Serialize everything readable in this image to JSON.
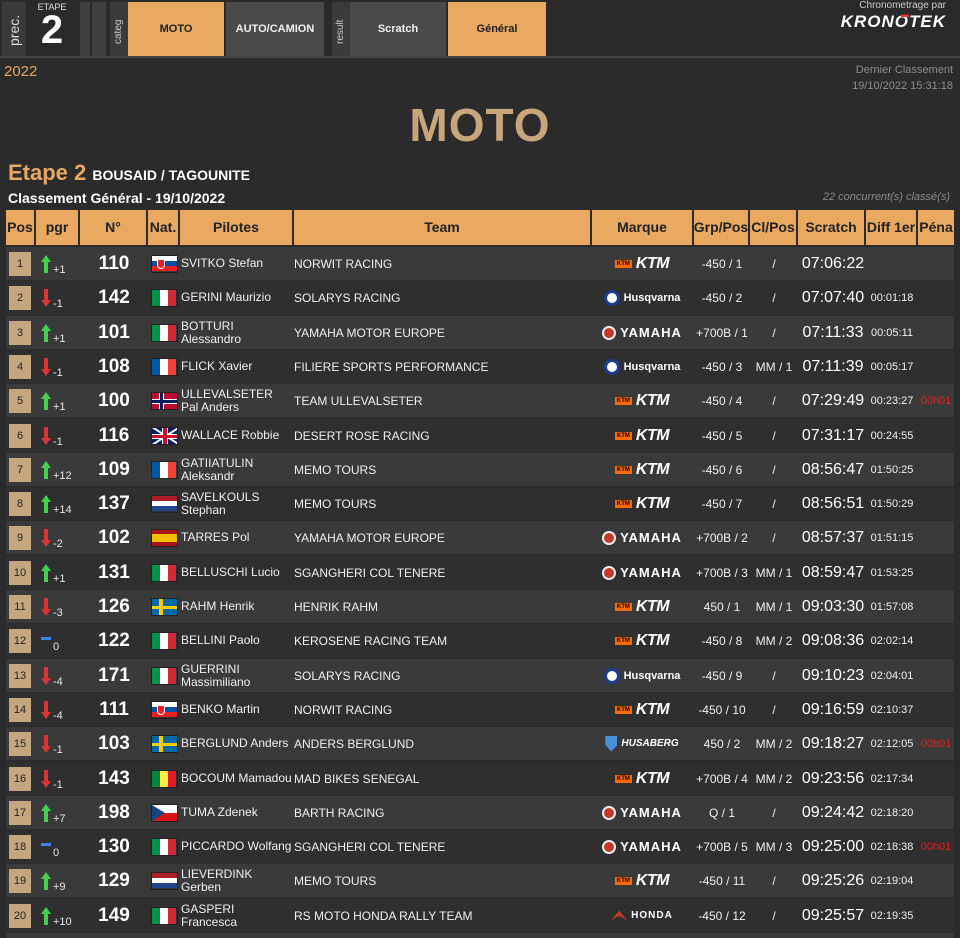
{
  "header": {
    "prec_label": "prec.",
    "etape_label": "ETAPE",
    "etape_num": "2",
    "categ_label": "categ",
    "result_label": "result",
    "tabs": [
      {
        "label": "MOTO",
        "active": true
      },
      {
        "label": "AUTO/CAMION",
        "active": false
      },
      {
        "label": "Scratch",
        "active": false
      },
      {
        "label": "Général",
        "active": true
      }
    ],
    "chrono_label": "Chronometrage par",
    "brand": "KRONOTEK"
  },
  "year": "2022",
  "dernier": {
    "label": "Dernier Classement",
    "datetime": "19/10/2022 15:31:18"
  },
  "page_title": "MOTO",
  "stage": {
    "etape": "Etape 2",
    "route": "BOUSAID / TAGOUNITE",
    "classement": "Classement Général - 19/10/2022",
    "concurrents": "22 concurrent(s) classé(s)"
  },
  "columns": [
    "Pos",
    "pgr",
    "N°",
    "Nat.",
    "Pilotes",
    "Team",
    "Marque",
    "Grp/Pos",
    "Cl/Pos",
    "Scratch",
    "Diff 1er",
    "Péna"
  ],
  "rows": [
    {
      "pos": "1",
      "dir": "up",
      "pgr": "+1",
      "no": "110",
      "nat": "SVK",
      "pilote": "SVITKO Stefan",
      "team": "NORWIT RACING",
      "marque": "KTM",
      "grp": "-450 / 1",
      "cl": "/",
      "scratch": "07:06:22",
      "diff": "",
      "pena": ""
    },
    {
      "pos": "2",
      "dir": "down",
      "pgr": "-1",
      "no": "142",
      "nat": "ITA",
      "pilote": "GERINI Maurizio",
      "team": "SOLARYS RACING",
      "marque": "Husqvarna",
      "grp": "-450 / 2",
      "cl": "/",
      "scratch": "07:07:40",
      "diff": "00:01:18",
      "pena": ""
    },
    {
      "pos": "3",
      "dir": "up",
      "pgr": "+1",
      "no": "101",
      "nat": "ITA",
      "pilote": "BOTTURI Alessandro",
      "team": "YAMAHA MOTOR EUROPE",
      "marque": "YAMAHA",
      "grp": "+700B / 1",
      "cl": "/",
      "scratch": "07:11:33",
      "diff": "00:05:11",
      "pena": ""
    },
    {
      "pos": "4",
      "dir": "down",
      "pgr": "-1",
      "no": "108",
      "nat": "FRA",
      "pilote": "FLICK Xavier",
      "team": "FILIERE SPORTS PERFORMANCE",
      "marque": "Husqvarna",
      "grp": "-450 / 3",
      "cl": "MM / 1",
      "scratch": "07:11:39",
      "diff": "00:05:17",
      "pena": ""
    },
    {
      "pos": "5",
      "dir": "up",
      "pgr": "+1",
      "no": "100",
      "nat": "NOR",
      "pilote": "ULLEVALSETER Pal Anders",
      "team": "TEAM ULLEVALSETER",
      "marque": "KTM",
      "grp": "-450 / 4",
      "cl": "/",
      "scratch": "07:29:49",
      "diff": "00:23:27",
      "pena": "00h01"
    },
    {
      "pos": "6",
      "dir": "down",
      "pgr": "-1",
      "no": "116",
      "nat": "GBR",
      "pilote": "WALLACE Robbie",
      "team": "DESERT ROSE RACING",
      "marque": "KTM",
      "grp": "-450 / 5",
      "cl": "/",
      "scratch": "07:31:17",
      "diff": "00:24:55",
      "pena": ""
    },
    {
      "pos": "7",
      "dir": "up",
      "pgr": "+12",
      "no": "109",
      "nat": "FRA",
      "pilote": "GATIIATULIN Aleksandr",
      "team": "MEMO TOURS",
      "marque": "KTM",
      "grp": "-450 / 6",
      "cl": "/",
      "scratch": "08:56:47",
      "diff": "01:50:25",
      "pena": ""
    },
    {
      "pos": "8",
      "dir": "up",
      "pgr": "+14",
      "no": "137",
      "nat": "NED",
      "pilote": "SAVELKOULS Stephan",
      "team": "MEMO TOURS",
      "marque": "KTM",
      "grp": "-450 / 7",
      "cl": "/",
      "scratch": "08:56:51",
      "diff": "01:50:29",
      "pena": ""
    },
    {
      "pos": "9",
      "dir": "down",
      "pgr": "-2",
      "no": "102",
      "nat": "ESP",
      "pilote": "TARRES Pol",
      "team": "YAMAHA MOTOR EUROPE",
      "marque": "YAMAHA",
      "grp": "+700B / 2",
      "cl": "/",
      "scratch": "08:57:37",
      "diff": "01:51:15",
      "pena": ""
    },
    {
      "pos": "10",
      "dir": "up",
      "pgr": "+1",
      "no": "131",
      "nat": "ITA",
      "pilote": "BELLUSCHI Lucio",
      "team": "SGANGHERI COL TENERE",
      "marque": "YAMAHA",
      "grp": "+700B / 3",
      "cl": "MM / 1",
      "scratch": "08:59:47",
      "diff": "01:53:25",
      "pena": ""
    },
    {
      "pos": "11",
      "dir": "down",
      "pgr": "-3",
      "no": "126",
      "nat": "SWE",
      "pilote": "RAHM Henrik",
      "team": "HENRIK RAHM",
      "marque": "KTM",
      "grp": "450 / 1",
      "cl": "MM / 1",
      "scratch": "09:03:30",
      "diff": "01:57:08",
      "pena": ""
    },
    {
      "pos": "12",
      "dir": "eq",
      "pgr": "0",
      "no": "122",
      "nat": "ITA",
      "pilote": "BELLINI Paolo",
      "team": "KEROSENE RACING TEAM",
      "marque": "KTM",
      "grp": "-450 / 8",
      "cl": "MM / 2",
      "scratch": "09:08:36",
      "diff": "02:02:14",
      "pena": ""
    },
    {
      "pos": "13",
      "dir": "down",
      "pgr": "-4",
      "no": "171",
      "nat": "ITA",
      "pilote": "GUERRINI Massimiliano",
      "team": "SOLARYS RACING",
      "marque": "Husqvarna",
      "grp": "-450 / 9",
      "cl": "/",
      "scratch": "09:10:23",
      "diff": "02:04:01",
      "pena": ""
    },
    {
      "pos": "14",
      "dir": "down",
      "pgr": "-4",
      "no": "111",
      "nat": "SVK",
      "pilote": "BENKO Martin",
      "team": "NORWIT RACING",
      "marque": "KTM",
      "grp": "-450 / 10",
      "cl": "/",
      "scratch": "09:16:59",
      "diff": "02:10:37",
      "pena": ""
    },
    {
      "pos": "15",
      "dir": "down",
      "pgr": "-1",
      "no": "103",
      "nat": "SWE",
      "pilote": "BERGLUND Anders",
      "team": "ANDERS BERGLUND",
      "marque": "HUSABERG",
      "grp": "450 / 2",
      "cl": "MM / 2",
      "scratch": "09:18:27",
      "diff": "02:12:05",
      "pena": "00h01"
    },
    {
      "pos": "16",
      "dir": "down",
      "pgr": "-1",
      "no": "143",
      "nat": "SEN",
      "pilote": "BOCOUM Mamadou",
      "team": "MAD BIKES SENEGAL",
      "marque": "KTM",
      "grp": "+700B / 4",
      "cl": "MM / 2",
      "scratch": "09:23:56",
      "diff": "02:17:34",
      "pena": ""
    },
    {
      "pos": "17",
      "dir": "up",
      "pgr": "+7",
      "no": "198",
      "nat": "CZE",
      "pilote": "TUMA Zdenek",
      "team": "BARTH RACING",
      "marque": "YAMAHA",
      "grp": "Q / 1",
      "cl": "/",
      "scratch": "09:24:42",
      "diff": "02:18:20",
      "pena": ""
    },
    {
      "pos": "18",
      "dir": "eq",
      "pgr": "0",
      "no": "130",
      "nat": "ITA",
      "pilote": "PICCARDO Wolfang",
      "team": "SGANGHERI COL TENERE",
      "marque": "YAMAHA",
      "grp": "+700B / 5",
      "cl": "MM / 3",
      "scratch": "09:25:00",
      "diff": "02:18:38",
      "pena": "00h01"
    },
    {
      "pos": "19",
      "dir": "up",
      "pgr": "+9",
      "no": "129",
      "nat": "NED",
      "pilote": "LIEVERDINK Gerben",
      "team": "MEMO TOURS",
      "marque": "KTM",
      "grp": "-450 / 11",
      "cl": "/",
      "scratch": "09:25:26",
      "diff": "02:19:04",
      "pena": ""
    },
    {
      "pos": "20",
      "dir": "up",
      "pgr": "+10",
      "no": "149",
      "nat": "ITA",
      "pilote": "GASPERI Francesca",
      "team": "RS MOTO HONDA RALLY TEAM",
      "marque": "HONDA",
      "grp": "-450 / 12",
      "cl": "/",
      "scratch": "09:25:57",
      "diff": "02:19:35",
      "pena": ""
    }
  ]
}
